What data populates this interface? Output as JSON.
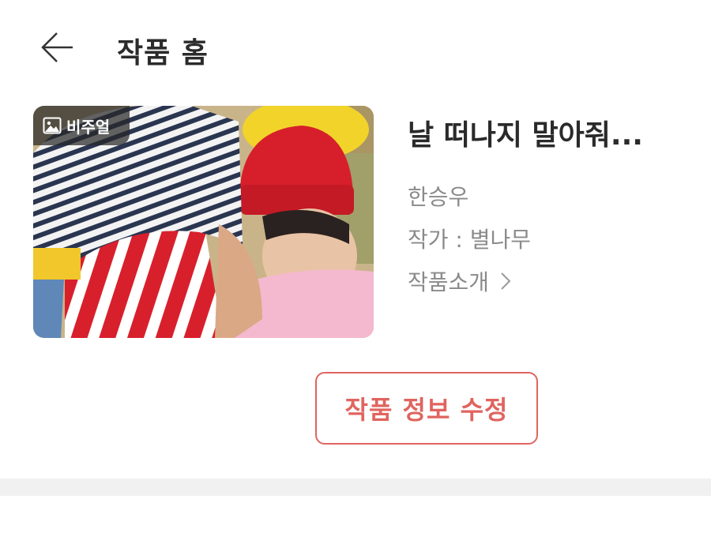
{
  "header": {
    "back_icon": "arrow-left-icon",
    "title": "작품 홈"
  },
  "work": {
    "visual_badge_icon": "image-icon",
    "visual_badge_label": "비주얼",
    "title": "날 떠나지 말아줘...",
    "character": "한승우",
    "author": "작가 : 별나무",
    "intro_label": "작품소개",
    "intro_icon": "chevron-right-icon"
  },
  "actions": {
    "edit_label": "작품 정보 수정"
  },
  "colors": {
    "accent": "#e0645f",
    "text_primary": "#2a2a2a",
    "text_secondary": "#8a8a8a",
    "divider": "#f1f1f2"
  }
}
